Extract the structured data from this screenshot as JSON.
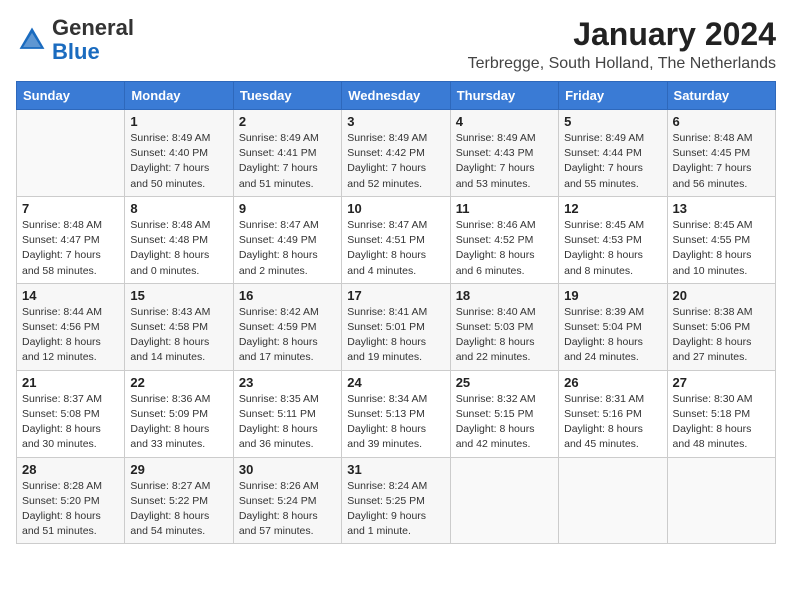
{
  "header": {
    "logo_general": "General",
    "logo_blue": "Blue",
    "month_title": "January 2024",
    "location": "Terbregge, South Holland, The Netherlands"
  },
  "days_of_week": [
    "Sunday",
    "Monday",
    "Tuesday",
    "Wednesday",
    "Thursday",
    "Friday",
    "Saturday"
  ],
  "weeks": [
    [
      {
        "day": "",
        "info": ""
      },
      {
        "day": "1",
        "info": "Sunrise: 8:49 AM\nSunset: 4:40 PM\nDaylight: 7 hours\nand 50 minutes."
      },
      {
        "day": "2",
        "info": "Sunrise: 8:49 AM\nSunset: 4:41 PM\nDaylight: 7 hours\nand 51 minutes."
      },
      {
        "day": "3",
        "info": "Sunrise: 8:49 AM\nSunset: 4:42 PM\nDaylight: 7 hours\nand 52 minutes."
      },
      {
        "day": "4",
        "info": "Sunrise: 8:49 AM\nSunset: 4:43 PM\nDaylight: 7 hours\nand 53 minutes."
      },
      {
        "day": "5",
        "info": "Sunrise: 8:49 AM\nSunset: 4:44 PM\nDaylight: 7 hours\nand 55 minutes."
      },
      {
        "day": "6",
        "info": "Sunrise: 8:48 AM\nSunset: 4:45 PM\nDaylight: 7 hours\nand 56 minutes."
      }
    ],
    [
      {
        "day": "7",
        "info": "Sunrise: 8:48 AM\nSunset: 4:47 PM\nDaylight: 7 hours\nand 58 minutes."
      },
      {
        "day": "8",
        "info": "Sunrise: 8:48 AM\nSunset: 4:48 PM\nDaylight: 8 hours\nand 0 minutes."
      },
      {
        "day": "9",
        "info": "Sunrise: 8:47 AM\nSunset: 4:49 PM\nDaylight: 8 hours\nand 2 minutes."
      },
      {
        "day": "10",
        "info": "Sunrise: 8:47 AM\nSunset: 4:51 PM\nDaylight: 8 hours\nand 4 minutes."
      },
      {
        "day": "11",
        "info": "Sunrise: 8:46 AM\nSunset: 4:52 PM\nDaylight: 8 hours\nand 6 minutes."
      },
      {
        "day": "12",
        "info": "Sunrise: 8:45 AM\nSunset: 4:53 PM\nDaylight: 8 hours\nand 8 minutes."
      },
      {
        "day": "13",
        "info": "Sunrise: 8:45 AM\nSunset: 4:55 PM\nDaylight: 8 hours\nand 10 minutes."
      }
    ],
    [
      {
        "day": "14",
        "info": "Sunrise: 8:44 AM\nSunset: 4:56 PM\nDaylight: 8 hours\nand 12 minutes."
      },
      {
        "day": "15",
        "info": "Sunrise: 8:43 AM\nSunset: 4:58 PM\nDaylight: 8 hours\nand 14 minutes."
      },
      {
        "day": "16",
        "info": "Sunrise: 8:42 AM\nSunset: 4:59 PM\nDaylight: 8 hours\nand 17 minutes."
      },
      {
        "day": "17",
        "info": "Sunrise: 8:41 AM\nSunset: 5:01 PM\nDaylight: 8 hours\nand 19 minutes."
      },
      {
        "day": "18",
        "info": "Sunrise: 8:40 AM\nSunset: 5:03 PM\nDaylight: 8 hours\nand 22 minutes."
      },
      {
        "day": "19",
        "info": "Sunrise: 8:39 AM\nSunset: 5:04 PM\nDaylight: 8 hours\nand 24 minutes."
      },
      {
        "day": "20",
        "info": "Sunrise: 8:38 AM\nSunset: 5:06 PM\nDaylight: 8 hours\nand 27 minutes."
      }
    ],
    [
      {
        "day": "21",
        "info": "Sunrise: 8:37 AM\nSunset: 5:08 PM\nDaylight: 8 hours\nand 30 minutes."
      },
      {
        "day": "22",
        "info": "Sunrise: 8:36 AM\nSunset: 5:09 PM\nDaylight: 8 hours\nand 33 minutes."
      },
      {
        "day": "23",
        "info": "Sunrise: 8:35 AM\nSunset: 5:11 PM\nDaylight: 8 hours\nand 36 minutes."
      },
      {
        "day": "24",
        "info": "Sunrise: 8:34 AM\nSunset: 5:13 PM\nDaylight: 8 hours\nand 39 minutes."
      },
      {
        "day": "25",
        "info": "Sunrise: 8:32 AM\nSunset: 5:15 PM\nDaylight: 8 hours\nand 42 minutes."
      },
      {
        "day": "26",
        "info": "Sunrise: 8:31 AM\nSunset: 5:16 PM\nDaylight: 8 hours\nand 45 minutes."
      },
      {
        "day": "27",
        "info": "Sunrise: 8:30 AM\nSunset: 5:18 PM\nDaylight: 8 hours\nand 48 minutes."
      }
    ],
    [
      {
        "day": "28",
        "info": "Sunrise: 8:28 AM\nSunset: 5:20 PM\nDaylight: 8 hours\nand 51 minutes."
      },
      {
        "day": "29",
        "info": "Sunrise: 8:27 AM\nSunset: 5:22 PM\nDaylight: 8 hours\nand 54 minutes."
      },
      {
        "day": "30",
        "info": "Sunrise: 8:26 AM\nSunset: 5:24 PM\nDaylight: 8 hours\nand 57 minutes."
      },
      {
        "day": "31",
        "info": "Sunrise: 8:24 AM\nSunset: 5:25 PM\nDaylight: 9 hours\nand 1 minute."
      },
      {
        "day": "",
        "info": ""
      },
      {
        "day": "",
        "info": ""
      },
      {
        "day": "",
        "info": ""
      }
    ]
  ]
}
